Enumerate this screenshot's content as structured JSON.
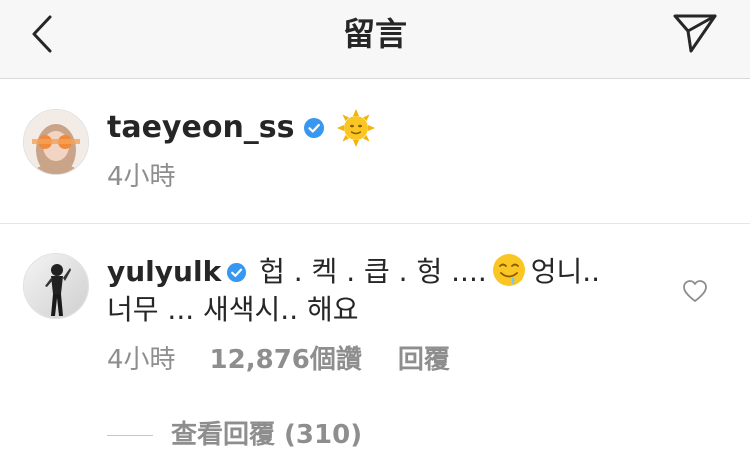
{
  "header": {
    "title": "留言"
  },
  "caption": {
    "username": "taeyeon_ss",
    "emoji": "sun-with-face",
    "timestamp": "4小時"
  },
  "comment": {
    "username": "yulyulk",
    "text": "헙 . 켁 . 큽 . 헝 ....",
    "emoji": "drooling-face",
    "text_after_emoji": "엉니..",
    "text_line2": "너무 ... 새색시.. 해요",
    "timestamp": "4小時",
    "likes": "12,876個讚",
    "reply_label": "回覆"
  },
  "replies": {
    "view_label": "查看回覆 (310)"
  },
  "colors": {
    "header_bg": "#f7f7f7",
    "text": "#262626",
    "meta": "#8e8e8e",
    "verified_blue": "#3897f0"
  }
}
